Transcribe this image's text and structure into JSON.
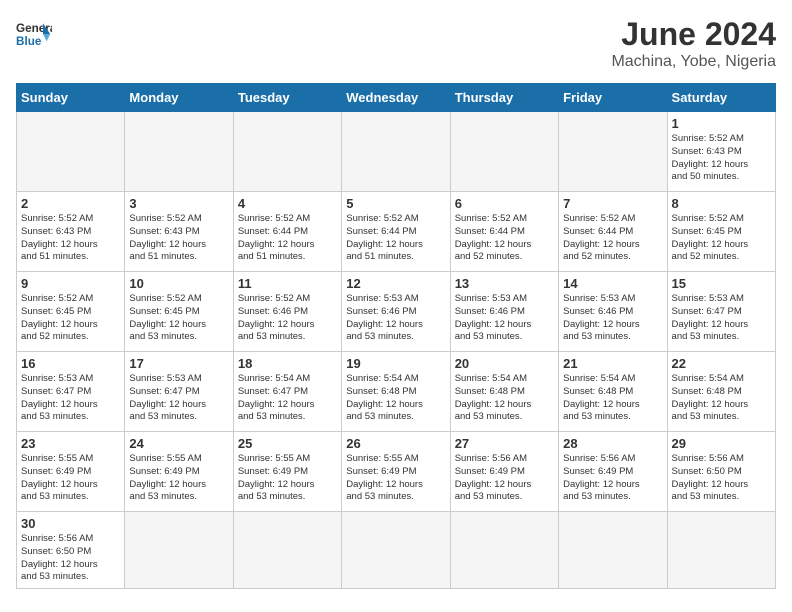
{
  "logo": {
    "text_general": "General",
    "text_blue": "Blue"
  },
  "title": "June 2024",
  "subtitle": "Machina, Yobe, Nigeria",
  "headers": [
    "Sunday",
    "Monday",
    "Tuesday",
    "Wednesday",
    "Thursday",
    "Friday",
    "Saturday"
  ],
  "weeks": [
    [
      {
        "day": "",
        "info": ""
      },
      {
        "day": "",
        "info": ""
      },
      {
        "day": "",
        "info": ""
      },
      {
        "day": "",
        "info": ""
      },
      {
        "day": "",
        "info": ""
      },
      {
        "day": "",
        "info": ""
      },
      {
        "day": "1",
        "info": "Sunrise: 5:52 AM\nSunset: 6:43 PM\nDaylight: 12 hours\nand 50 minutes."
      }
    ],
    [
      {
        "day": "2",
        "info": "Sunrise: 5:52 AM\nSunset: 6:43 PM\nDaylight: 12 hours\nand 51 minutes."
      },
      {
        "day": "3",
        "info": "Sunrise: 5:52 AM\nSunset: 6:43 PM\nDaylight: 12 hours\nand 51 minutes."
      },
      {
        "day": "4",
        "info": "Sunrise: 5:52 AM\nSunset: 6:44 PM\nDaylight: 12 hours\nand 51 minutes."
      },
      {
        "day": "5",
        "info": "Sunrise: 5:52 AM\nSunset: 6:44 PM\nDaylight: 12 hours\nand 51 minutes."
      },
      {
        "day": "6",
        "info": "Sunrise: 5:52 AM\nSunset: 6:44 PM\nDaylight: 12 hours\nand 52 minutes."
      },
      {
        "day": "7",
        "info": "Sunrise: 5:52 AM\nSunset: 6:44 PM\nDaylight: 12 hours\nand 52 minutes."
      },
      {
        "day": "8",
        "info": "Sunrise: 5:52 AM\nSunset: 6:45 PM\nDaylight: 12 hours\nand 52 minutes."
      }
    ],
    [
      {
        "day": "9",
        "info": "Sunrise: 5:52 AM\nSunset: 6:45 PM\nDaylight: 12 hours\nand 52 minutes."
      },
      {
        "day": "10",
        "info": "Sunrise: 5:52 AM\nSunset: 6:45 PM\nDaylight: 12 hours\nand 53 minutes."
      },
      {
        "day": "11",
        "info": "Sunrise: 5:52 AM\nSunset: 6:46 PM\nDaylight: 12 hours\nand 53 minutes."
      },
      {
        "day": "12",
        "info": "Sunrise: 5:53 AM\nSunset: 6:46 PM\nDaylight: 12 hours\nand 53 minutes."
      },
      {
        "day": "13",
        "info": "Sunrise: 5:53 AM\nSunset: 6:46 PM\nDaylight: 12 hours\nand 53 minutes."
      },
      {
        "day": "14",
        "info": "Sunrise: 5:53 AM\nSunset: 6:46 PM\nDaylight: 12 hours\nand 53 minutes."
      },
      {
        "day": "15",
        "info": "Sunrise: 5:53 AM\nSunset: 6:47 PM\nDaylight: 12 hours\nand 53 minutes."
      }
    ],
    [
      {
        "day": "16",
        "info": "Sunrise: 5:53 AM\nSunset: 6:47 PM\nDaylight: 12 hours\nand 53 minutes."
      },
      {
        "day": "17",
        "info": "Sunrise: 5:53 AM\nSunset: 6:47 PM\nDaylight: 12 hours\nand 53 minutes."
      },
      {
        "day": "18",
        "info": "Sunrise: 5:54 AM\nSunset: 6:47 PM\nDaylight: 12 hours\nand 53 minutes."
      },
      {
        "day": "19",
        "info": "Sunrise: 5:54 AM\nSunset: 6:48 PM\nDaylight: 12 hours\nand 53 minutes."
      },
      {
        "day": "20",
        "info": "Sunrise: 5:54 AM\nSunset: 6:48 PM\nDaylight: 12 hours\nand 53 minutes."
      },
      {
        "day": "21",
        "info": "Sunrise: 5:54 AM\nSunset: 6:48 PM\nDaylight: 12 hours\nand 53 minutes."
      },
      {
        "day": "22",
        "info": "Sunrise: 5:54 AM\nSunset: 6:48 PM\nDaylight: 12 hours\nand 53 minutes."
      }
    ],
    [
      {
        "day": "23",
        "info": "Sunrise: 5:55 AM\nSunset: 6:49 PM\nDaylight: 12 hours\nand 53 minutes."
      },
      {
        "day": "24",
        "info": "Sunrise: 5:55 AM\nSunset: 6:49 PM\nDaylight: 12 hours\nand 53 minutes."
      },
      {
        "day": "25",
        "info": "Sunrise: 5:55 AM\nSunset: 6:49 PM\nDaylight: 12 hours\nand 53 minutes."
      },
      {
        "day": "26",
        "info": "Sunrise: 5:55 AM\nSunset: 6:49 PM\nDaylight: 12 hours\nand 53 minutes."
      },
      {
        "day": "27",
        "info": "Sunrise: 5:56 AM\nSunset: 6:49 PM\nDaylight: 12 hours\nand 53 minutes."
      },
      {
        "day": "28",
        "info": "Sunrise: 5:56 AM\nSunset: 6:49 PM\nDaylight: 12 hours\nand 53 minutes."
      },
      {
        "day": "29",
        "info": "Sunrise: 5:56 AM\nSunset: 6:50 PM\nDaylight: 12 hours\nand 53 minutes."
      }
    ],
    [
      {
        "day": "30",
        "info": "Sunrise: 5:56 AM\nSunset: 6:50 PM\nDaylight: 12 hours\nand 53 minutes."
      },
      {
        "day": "",
        "info": ""
      },
      {
        "day": "",
        "info": ""
      },
      {
        "day": "",
        "info": ""
      },
      {
        "day": "",
        "info": ""
      },
      {
        "day": "",
        "info": ""
      },
      {
        "day": "",
        "info": ""
      }
    ]
  ]
}
